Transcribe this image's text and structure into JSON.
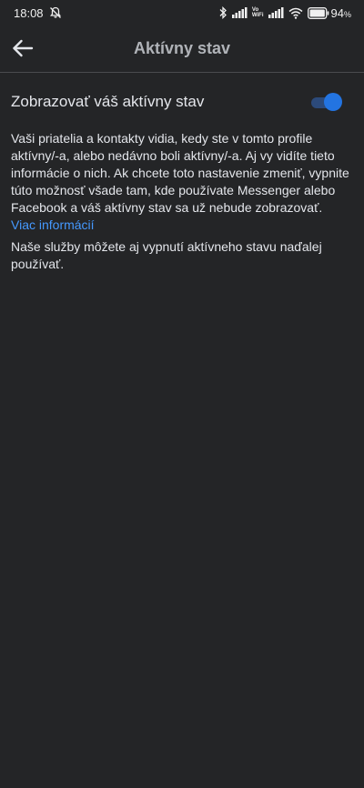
{
  "status_bar": {
    "time": "18:08",
    "wifi_label_top": "Vo",
    "wifi_label_bottom": "WiFi",
    "battery_percent": "94",
    "battery_suffix": "%",
    "battery_level": 0.94,
    "icons": [
      "mute-bell-icon",
      "bluetooth-icon",
      "signal-icon",
      "vowifi-icon",
      "signal-icon",
      "wifi-icon",
      "battery-icon"
    ]
  },
  "header": {
    "title": "Aktívny stav",
    "back_icon": "back-arrow-icon"
  },
  "setting": {
    "label": "Zobrazovať váš aktívny stav",
    "enabled": true,
    "accent_color": "#2374e1"
  },
  "description": {
    "text": "Vaši priatelia a kontakty vidia, kedy ste v tomto profile aktívny/-a, alebo nedávno boli aktívny/-a. Aj vy vidíte tieto informácie o nich. Ak chcete toto nastavenie zmeniť, vypnite túto možnosť všade tam, kde používate Messenger alebo Facebook a váš aktívny stav sa už nebude zobrazovať. ",
    "link_label": "Viac informácií",
    "link_color": "#4599ff"
  },
  "note": {
    "text": "Naše služby môžete aj vypnutí aktívneho stavu naďalej používať."
  }
}
